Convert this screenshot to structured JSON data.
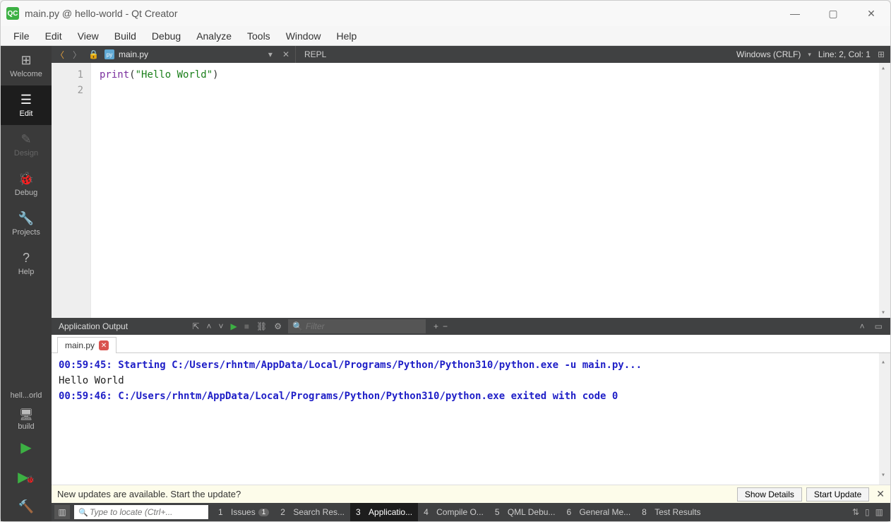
{
  "window": {
    "app_icon_text": "QC",
    "title": "main.py @ hello-world - Qt Creator"
  },
  "menubar": [
    "File",
    "Edit",
    "View",
    "Build",
    "Debug",
    "Analyze",
    "Tools",
    "Window",
    "Help"
  ],
  "sidebar": {
    "modes": [
      {
        "id": "welcome",
        "label": "Welcome",
        "icon": "⊞"
      },
      {
        "id": "edit",
        "label": "Edit",
        "icon": "☰",
        "active": true
      },
      {
        "id": "design",
        "label": "Design",
        "icon": "✎",
        "disabled": true
      },
      {
        "id": "debug",
        "label": "Debug",
        "icon": "🐞"
      },
      {
        "id": "projects",
        "label": "Projects",
        "icon": "🔧"
      },
      {
        "id": "help",
        "label": "Help",
        "icon": "?"
      }
    ],
    "kit": "hell...orld",
    "target": "build"
  },
  "filetab": {
    "filename": "main.py",
    "repl_label": "REPL",
    "encoding": "Windows (CRLF)",
    "line_col": "Line: 2, Col: 1"
  },
  "code": {
    "lines": [
      {
        "n": "1",
        "tokens": [
          {
            "cls": "tok-func",
            "t": "print"
          },
          {
            "cls": "tok-paren",
            "t": "("
          },
          {
            "cls": "tok-str",
            "t": "\"Hello World\""
          },
          {
            "cls": "tok-paren",
            "t": ")"
          }
        ]
      },
      {
        "n": "2",
        "tokens": []
      }
    ]
  },
  "output_panel": {
    "title": "Application Output",
    "filter_placeholder": "Filter",
    "tab_label": "main.py",
    "lines": [
      {
        "cls": "out-blue",
        "t": "00:59:45: Starting C:/Users/rhntm/AppData/Local/Programs/Python/Python310/python.exe -u main.py..."
      },
      {
        "cls": "out-plain",
        "t": "Hello World"
      },
      {
        "cls": "out-blue",
        "t": "00:59:46: C:/Users/rhntm/AppData/Local/Programs/Python/Python310/python.exe exited with code 0"
      }
    ]
  },
  "update_bar": {
    "message": "New updates are available. Start the update?",
    "show_details": "Show Details",
    "start_update": "Start Update"
  },
  "bottombar": {
    "locator_placeholder": "Type to locate (Ctrl+...",
    "panels": [
      {
        "n": "1",
        "label": "Issues",
        "badge": "1"
      },
      {
        "n": "2",
        "label": "Search Res..."
      },
      {
        "n": "3",
        "label": "Applicatio...",
        "active": true
      },
      {
        "n": "4",
        "label": "Compile O..."
      },
      {
        "n": "5",
        "label": "QML Debu..."
      },
      {
        "n": "6",
        "label": "General Me..."
      },
      {
        "n": "8",
        "label": "Test Results"
      }
    ]
  }
}
